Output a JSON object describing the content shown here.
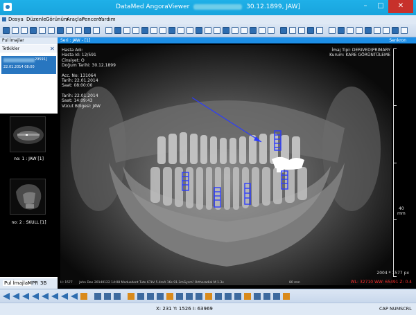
{
  "window": {
    "title_prefix": "DataMed AngoraViewer",
    "title_suffix": "30.12.1899, JAW]"
  },
  "menu": [
    "Dosya",
    "Düzenle",
    "Görünüm",
    "Araçlar",
    "Pencere",
    "Yardım"
  ],
  "left_panel": {
    "header": "Pul İmajlar",
    "studies_tab": "Tetkikler",
    "study": {
      "id": "29591]",
      "datetime": "22.01.2014 08:00"
    },
    "series": [
      {
        "label": "no: 1 : JAW [1]"
      },
      {
        "label": "no: 2 : SKULL [1]"
      }
    ],
    "tabs": [
      "Pul İmajlar",
      "MPR",
      "3B"
    ]
  },
  "viewer": {
    "series_label": "Seri : JAW - [1]",
    "sync_label": "Senkron",
    "top_left": [
      "Hasta Adı:",
      "Hasta Id: 12/591",
      "Cinsiyet: O",
      "Doğum Tarihi: 30.12.1899",
      "",
      "Acc. No: 131064",
      "Tarih: 22.01.2014",
      "Saat: 08:00:00",
      "",
      "Tarih: 22.01.2014",
      "Saat: 14:09:43",
      "Vücut Bölgesi: JAW"
    ],
    "top_right": [
      "İmaj Tipi: DERIVED\\PRIMARY",
      "Kurum: KARE GÖRÜNTÜLEME"
    ],
    "ruler": {
      "value": "40",
      "unit": "mm"
    },
    "scale_text": "2004 * 1577 px",
    "bottom_left": "H: 1577",
    "bottom_info": "John Doe 20140122 14:08 Medusdent Tuto 67kV 5.4mA 16s 91.3mGycm² Orthoradial M 1.3x",
    "scale_mm": "80 mm",
    "window_level": "WL: 32710 WW: 65491 Z: 0.4"
  },
  "status": {
    "coords": "X: 231 Y: 1526 I: 63969",
    "keys": [
      "CAP",
      "NUM",
      "SCRL"
    ]
  },
  "colors": {
    "title_bar": "#1ba8e0",
    "accent_blue": "#1e8fe6",
    "implant_blue": "#2b3bff",
    "close_red": "#c7312b",
    "overlay_red": "#ff3030"
  }
}
